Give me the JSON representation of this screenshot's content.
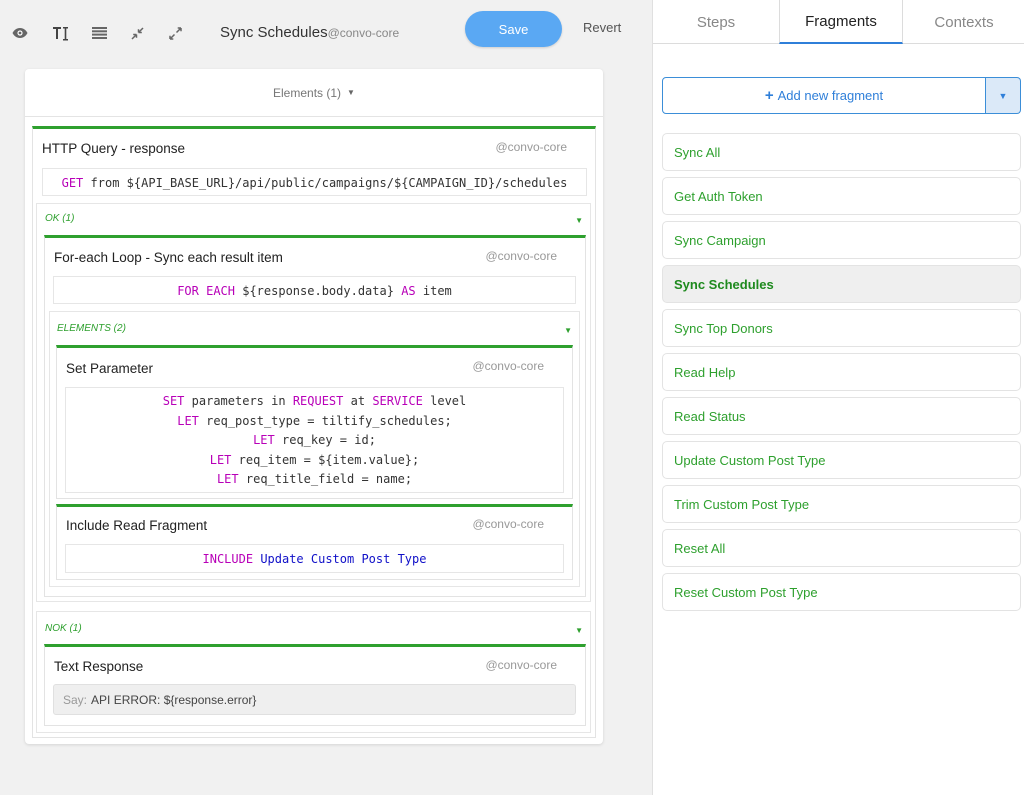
{
  "toolbar": {
    "icons": [
      "eye-icon",
      "text-icon",
      "list-icon",
      "collapse-icon",
      "expand-icon"
    ],
    "title": "Sync Schedules",
    "owner": "@convo-core",
    "save_label": "Save",
    "revert_label": "Revert"
  },
  "editor": {
    "elements_header": "Elements (1)",
    "http": {
      "title": "HTTP Query - response",
      "owner": "@convo-core",
      "method": "GET",
      "from_kw": "from",
      "url": "${API_BASE_URL}/api/public/campaigns/${CAMPAIGN_ID}/schedules"
    },
    "ok_label": "OK (1)",
    "loop": {
      "title": "For-each Loop - Sync each result item",
      "owner": "@convo-core",
      "for_each_kw": "FOR EACH",
      "expr": "${response.body.data}",
      "as_kw": "AS",
      "item": "item"
    },
    "elements2_label": "ELEMENTS (2)",
    "set_param": {
      "title": "Set Parameter",
      "owner": "@convo-core",
      "set_kw": "SET",
      "parameters_in": "parameters in",
      "request_kw": "REQUEST",
      "at": "at",
      "service_kw": "SERVICE",
      "level": "level",
      "let_kw": "LET",
      "lines": [
        "req_post_type = tiltify_schedules;",
        "req_key = id;",
        "req_item = ${item.value};",
        "req_title_field = name;"
      ]
    },
    "include": {
      "title": "Include Read Fragment",
      "owner": "@convo-core",
      "include_kw": "INCLUDE",
      "fragment": "Update Custom Post Type"
    },
    "nok_label": "NOK (1)",
    "text_response": {
      "title": "Text Response",
      "owner": "@convo-core",
      "say_label": "Say:",
      "say_text": "API ERROR: ${response.error}"
    }
  },
  "panel": {
    "tabs": [
      "Steps",
      "Fragments",
      "Contexts"
    ],
    "active_tab": "Fragments",
    "add_label": "Add new fragment",
    "fragments": [
      "Sync All",
      "Get Auth Token",
      "Sync Campaign",
      "Sync Schedules",
      "Sync Top Donors",
      "Read Help",
      "Read Status",
      "Update Custom Post Type",
      "Trim Custom Post Type",
      "Reset All",
      "Reset Custom Post Type"
    ],
    "active_fragment": "Sync Schedules"
  },
  "colors": {
    "accent_green": "#2ea02e",
    "save_blue": "#5aa8f3",
    "link_blue": "#2f7fd9",
    "keyword_magenta": "#b800b8",
    "keyword_blue": "#1010c8"
  }
}
